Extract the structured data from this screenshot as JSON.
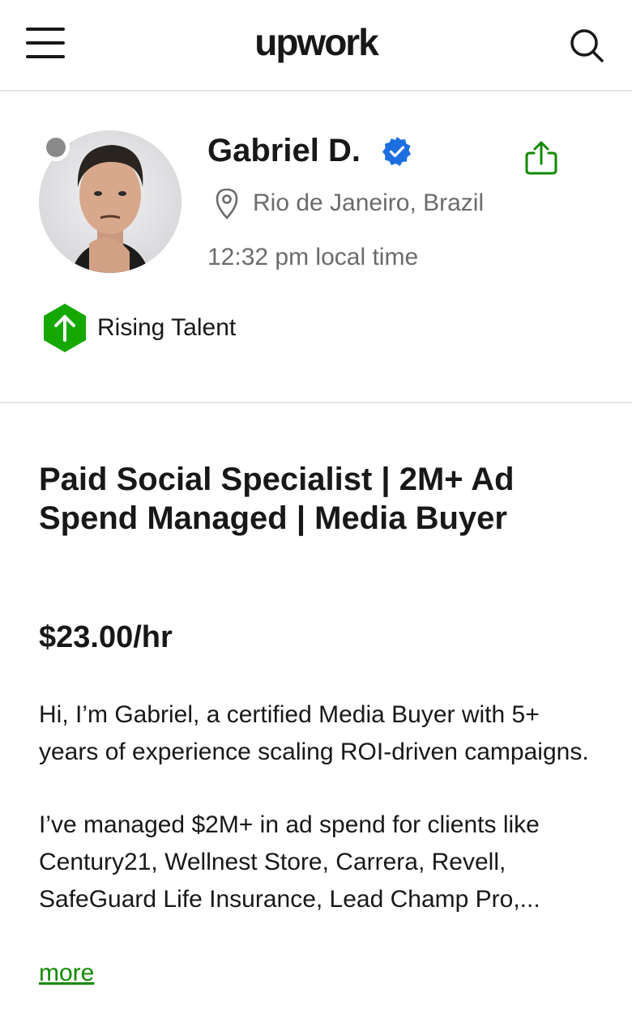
{
  "header": {
    "logo_text": "upwork",
    "menu_icon": "hamburger-menu-icon",
    "search_icon": "search-icon"
  },
  "profile": {
    "name": "Gabriel D.",
    "verified_icon": "verified-badge-icon",
    "location": "Rio de Janeiro, Brazil",
    "local_time": "12:32 pm local time",
    "badge": "Rising Talent",
    "status": "offline"
  },
  "main": {
    "title": "Paid Social Specialist | 2M+ Ad Spend Managed | Media Buyer",
    "rate": "$23.00/hr",
    "overview_p1": "Hi, I’m Gabriel, a certified Media Buyer with 5+ years of experience scaling ROI-driven campaigns.",
    "overview_p2": "I’ve managed $2M+ in ad spend for clients like Century21, Wellnest Store, Carrera, Revell, SafeGuard Life Insurance, Lead Champ Pro,...",
    "more_label": "more"
  },
  "colors": {
    "brand_green": "#108a00",
    "verified_blue": "#1d6fe0",
    "text_primary": "#181818",
    "text_muted": "#6b6b6b"
  }
}
